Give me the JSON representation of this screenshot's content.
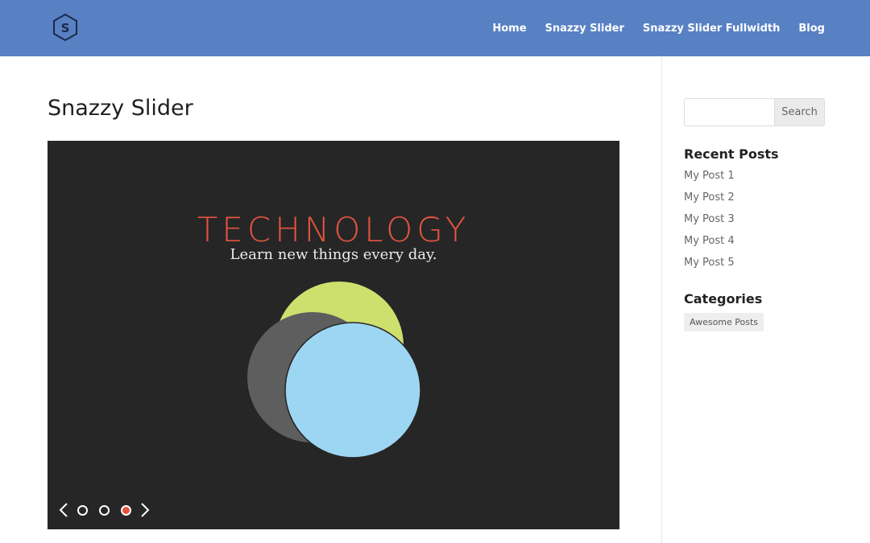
{
  "header": {
    "logo_letter": "S",
    "nav": [
      "Home",
      "Snazzy Slider",
      "Snazzy Slider Fullwidth",
      "Blog"
    ],
    "background": "#5881c4"
  },
  "main": {
    "title": "Snazzy Slider",
    "slider": {
      "title": "TECHNOLOGY",
      "subtitle": "Learn new things every day.",
      "slide_count": 3,
      "active_slide": 3,
      "colors": {
        "background": "#262626",
        "title": "#e2553f",
        "circle_green": "#cde06e",
        "circle_gray": "#5e5e5e",
        "circle_blue": "#9dd6f2"
      },
      "icons": {
        "prev": "chevron-left-icon",
        "next": "chevron-right-icon"
      }
    }
  },
  "sidebar": {
    "search": {
      "placeholder": "",
      "button": "Search"
    },
    "recent_posts_title": "Recent Posts",
    "recent_posts": [
      "My Post 1",
      "My Post 2",
      "My Post 3",
      "My Post 4",
      "My Post 5"
    ],
    "categories_title": "Categories",
    "categories": [
      "Awesome Posts"
    ]
  }
}
